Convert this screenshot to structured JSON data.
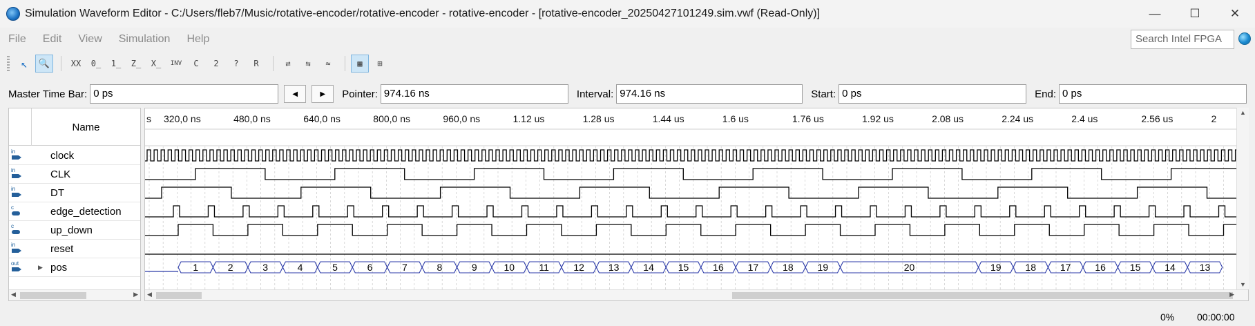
{
  "window": {
    "title": "Simulation Waveform Editor - C:/Users/fleb7/Music/rotative-encoder/rotative-encoder - rotative-encoder - [rotative-encoder_20250427101249.sim.vwf (Read-Only)]",
    "minimize": "—",
    "maximize": "☐",
    "close": "✕"
  },
  "menu": [
    "File",
    "Edit",
    "View",
    "Simulation",
    "Help"
  ],
  "search": {
    "placeholder": "Search Intel FPGA"
  },
  "toolbar": {
    "buttons": [
      "↖",
      "🔍",
      "XX",
      "0̲",
      "1̲",
      "Z̲",
      "X̲",
      "INV",
      "C",
      "2",
      "?",
      "R",
      "⇄",
      "⇆",
      "≈",
      "▦",
      "⊞"
    ]
  },
  "time_bar": {
    "master_label": "Master Time Bar:",
    "master_value": "0 ps",
    "prev": "◀",
    "next": "▶",
    "pointer_label": "Pointer:",
    "pointer_value": "974.16 ns",
    "interval_label": "Interval:",
    "interval_value": "974.16 ns",
    "start_label": "Start:",
    "start_value": "0 ps",
    "end_label": "End:",
    "end_value": "0 ps"
  },
  "names_panel": {
    "header": "Name",
    "signals": [
      {
        "name": "clock",
        "dir": "in"
      },
      {
        "name": "CLK",
        "dir": "in"
      },
      {
        "name": "DT",
        "dir": "in"
      },
      {
        "name": "edge_detection",
        "dir": "c"
      },
      {
        "name": "up_down",
        "dir": "c"
      },
      {
        "name": "reset",
        "dir": "in"
      },
      {
        "name": "pos",
        "dir": "out",
        "expandable": true
      }
    ]
  },
  "timeline": {
    "ticks": [
      "s",
      "320,0 ns",
      "480,0 ns",
      "640,0 ns",
      "800,0 ns",
      "960,0 ns",
      "1.12 us",
      "1.28 us",
      "1.44 us",
      "1.6 us",
      "1.76 us",
      "1.92 us",
      "2.08 us",
      "2.24 us",
      "2.4 us",
      "2.56 us",
      "2"
    ]
  },
  "waves": {
    "pos_values": [
      "1",
      "2",
      "3",
      "4",
      "5",
      "6",
      "7",
      "8",
      "9",
      "10",
      "11",
      "12",
      "13",
      "14",
      "15",
      "16",
      "17",
      "18",
      "19",
      "20",
      "19",
      "18",
      "17",
      "16",
      "15",
      "14",
      "13"
    ]
  },
  "status": {
    "percent": "0%",
    "elapsed": "00:00:00"
  }
}
